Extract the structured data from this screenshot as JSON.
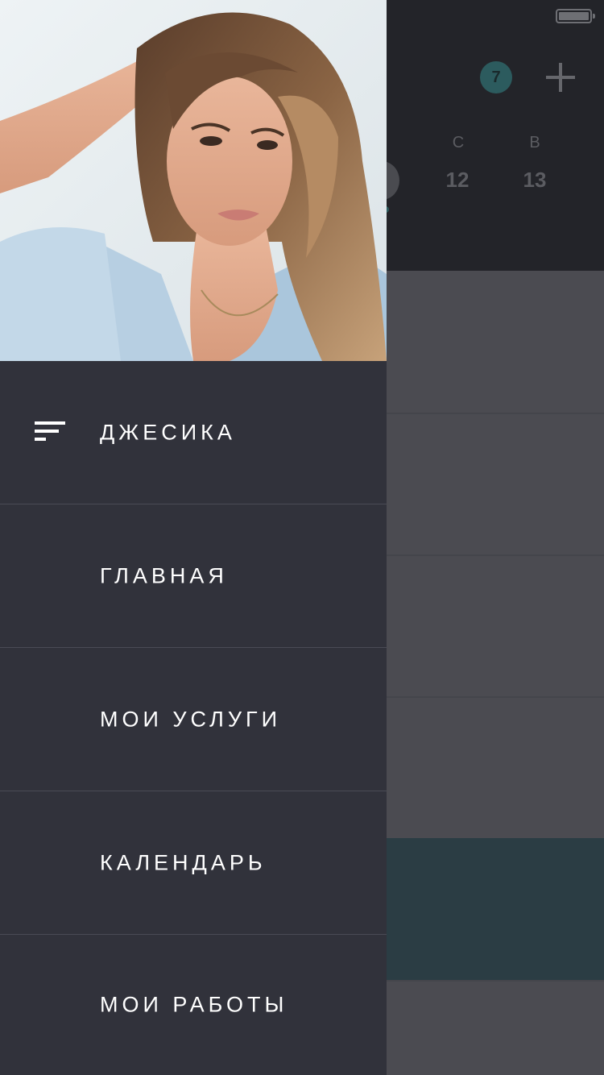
{
  "background": {
    "badge_count": "7",
    "days": [
      {
        "letter": "С",
        "number": "12"
      },
      {
        "letter": "В",
        "number": "13"
      }
    ]
  },
  "drawer": {
    "profile": {
      "name": "ДЖЕСИКА"
    },
    "items": [
      {
        "label": "ГЛАВНАЯ"
      },
      {
        "label": "МОИ УСЛУГИ"
      },
      {
        "label": "КАЛЕНДАРЬ"
      },
      {
        "label": "МОИ РАБОТЫ"
      }
    ]
  },
  "colors": {
    "drawer_bg": "#31323b",
    "divider": "#4a4b55",
    "accent_teal": "#2c5b5e",
    "text": "#ffffff"
  }
}
